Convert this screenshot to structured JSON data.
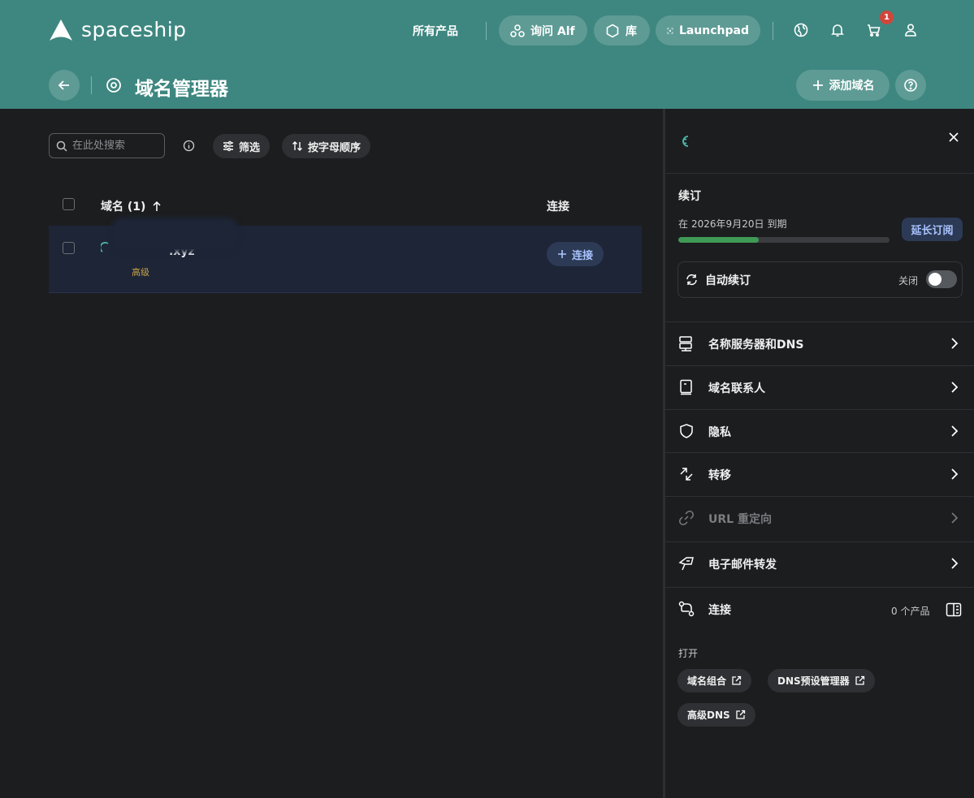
{
  "colors": {
    "brand_teal": "#3e8780",
    "background": "#1c1d1f",
    "accent_blue": "#a9c4ff",
    "progress_green": "#3f9a55",
    "badge_red": "#d1453b",
    "tier_gold": "#c8a34a"
  },
  "header": {
    "logo_text": "spaceship",
    "all_products": "所有产品",
    "ask_alf": "询问 Alf",
    "library": "库",
    "launchpad": "Launchpad",
    "cart_badge": "1",
    "page_title": "域名管理器",
    "add_domain": "添加域名"
  },
  "toolbar": {
    "search_placeholder": "在此处搜索",
    "filter": "筛选",
    "sort": "按字母顺序"
  },
  "table": {
    "col_domain": "域名 (1)",
    "col_connect": "连接",
    "rows": [
      {
        "domain_suffix": ".xyz",
        "tier": "高级",
        "connect": "连接"
      }
    ]
  },
  "panel": {
    "renewal_title": "续订",
    "expiry_prefix": "在",
    "expiry_date": "2026年9月20日",
    "expiry_suffix": "到期",
    "renewal_progress": 0.38,
    "extend_button": "延长订阅",
    "auto_renew_label": "自动续订",
    "auto_renew_state": "关闭",
    "menu": [
      {
        "label": "名称服务器和DNS",
        "icon": "server-icon"
      },
      {
        "label": "域名联系人",
        "icon": "contact-book-icon"
      },
      {
        "label": "隐私",
        "icon": "shield-icon"
      },
      {
        "label": "转移",
        "icon": "transfer-icon"
      },
      {
        "label": "URL 重定向",
        "icon": "link-icon",
        "disabled": true
      },
      {
        "label": "电子邮件转发",
        "icon": "email-forward-icon"
      }
    ],
    "connect_label": "连接",
    "connect_count": "0 个产品",
    "open_title": "打开",
    "open_links": [
      "域名组合",
      "DNS预设管理器",
      "高级DNS"
    ]
  }
}
